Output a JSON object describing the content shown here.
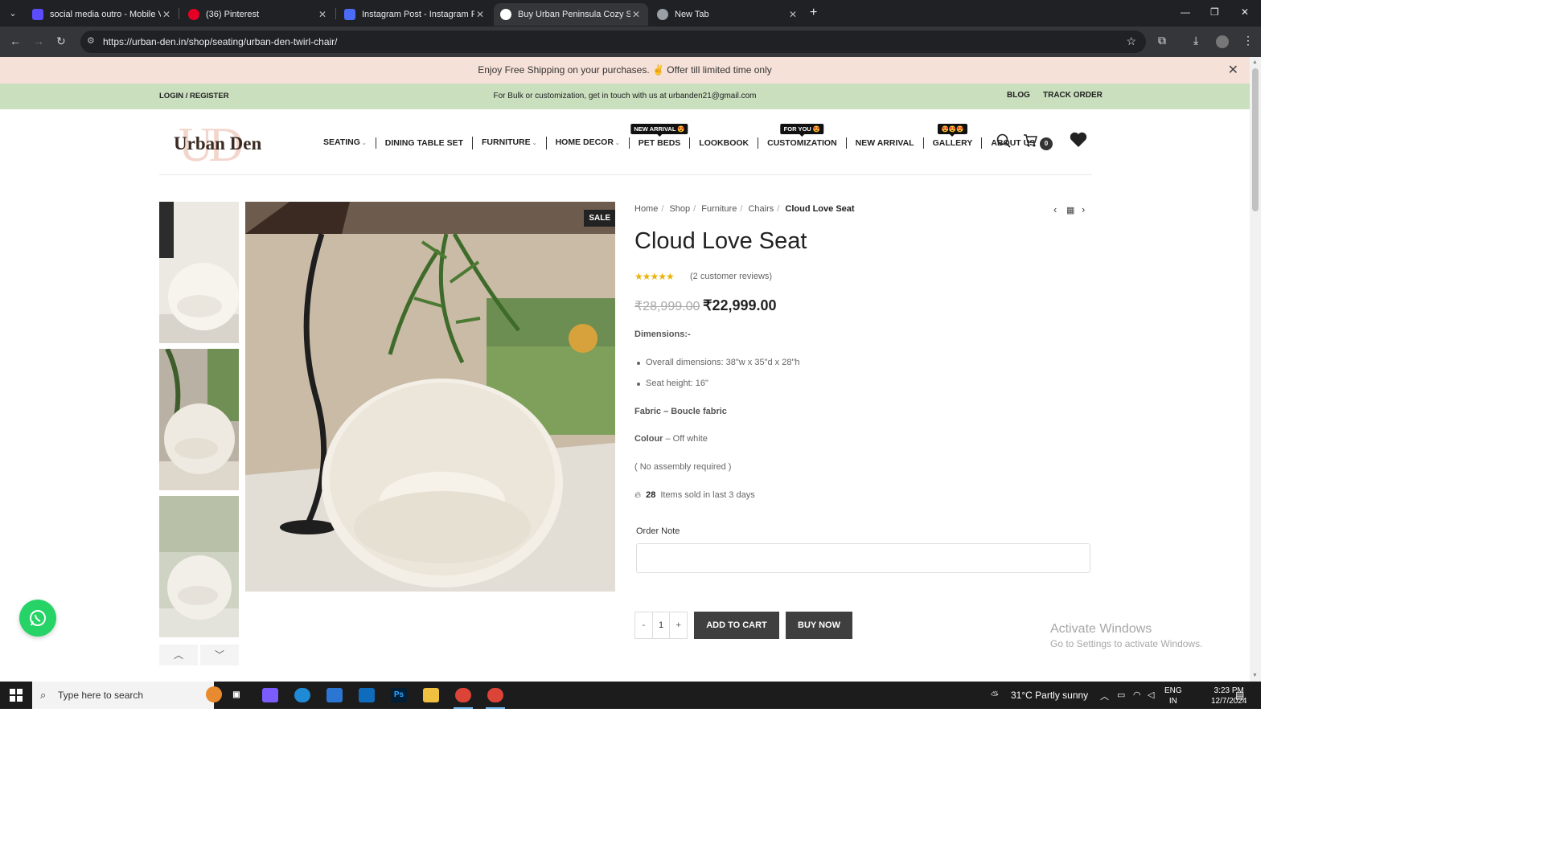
{
  "browser": {
    "tabs": [
      {
        "title": "social media outro - Mobile Vid",
        "favicon_color": "#5b4cff"
      },
      {
        "title": "(36) Pinterest",
        "favicon_color": "#e60023"
      },
      {
        "title": "Instagram Post - Instagram Pos",
        "favicon_color": "#4a6cf7"
      },
      {
        "title": "Buy Urban Peninsula Cozy Swiv",
        "favicon_color": "#ffffff"
      },
      {
        "title": "New Tab",
        "favicon_color": "#9aa0a6"
      }
    ],
    "url": "https://urban-den.in/shop/seating/urban-den-twirl-chair/"
  },
  "promo": {
    "text": "Enjoy Free Shipping on your purchases. ✌ Offer till limited time only"
  },
  "topbar": {
    "login": "LOGIN / REGISTER",
    "contact": "For Bulk or customization, get in touch with us at urbanden21@gmail.com",
    "blog": "BLOG",
    "track": "TRACK ORDER"
  },
  "header": {
    "logo_text": "Urban Den",
    "logo_mark": "UD",
    "menu": [
      {
        "label": "SEATING",
        "badge": ""
      },
      {
        "label": "DINING TABLE SET",
        "badge": ""
      },
      {
        "label": "FURNITURE",
        "badge": ""
      },
      {
        "label": "HOME DECOR",
        "badge": ""
      },
      {
        "label": "PET BEDS",
        "badge": "NEW ARRIVAL 😍"
      },
      {
        "label": "LOOKBOOK",
        "badge": ""
      },
      {
        "label": "CUSTOMIZATION",
        "badge": "FOR YOU 😍"
      },
      {
        "label": "NEW ARRIVAL",
        "badge": ""
      },
      {
        "label": "GALLERY",
        "badge": "😍😍😍"
      },
      {
        "label": "ABOUT US",
        "badge": ""
      }
    ],
    "cart_count": "0"
  },
  "product": {
    "sale_badge": "SALE",
    "breadcrumbs": [
      "Home",
      "Shop",
      "Furniture",
      "Chairs"
    ],
    "breadcrumb_current": "Cloud Love Seat",
    "title": "Cloud Love Seat",
    "rating": 5,
    "rating_stars": "★★★★★",
    "reviews": "(2 customer reviews)",
    "price_old": "₹28,999.00",
    "price_new": "₹22,999.00",
    "dimensions_heading": "Dimensions:-",
    "dimensions": [
      "Overall dimensions: 38\"w x 35\"d x 28\"h",
      "Seat height: 16\""
    ],
    "fabric_label": "Fabric – Boucle fabric",
    "colour_label": "Colour",
    "colour_value": " – Off white",
    "assembly": "( No assembly required )",
    "sold_count": "28",
    "sold_text": "Items sold in last 3 days",
    "order_note_label": "Order Note",
    "order_note_value": "",
    "qty_minus": "-",
    "qty": "1",
    "qty_plus": "+",
    "add_to_cart": "ADD TO CART",
    "buy_now": "BUY NOW"
  },
  "watermark": {
    "line1": "Activate Windows",
    "line2": "Go to Settings to activate Windows."
  },
  "taskbar": {
    "search_placeholder": "Type here to search",
    "weather": "31°C  Partly sunny",
    "lang1": "ENG",
    "lang2": "IN",
    "time": "3:23 PM",
    "date": "12/7/2024"
  }
}
